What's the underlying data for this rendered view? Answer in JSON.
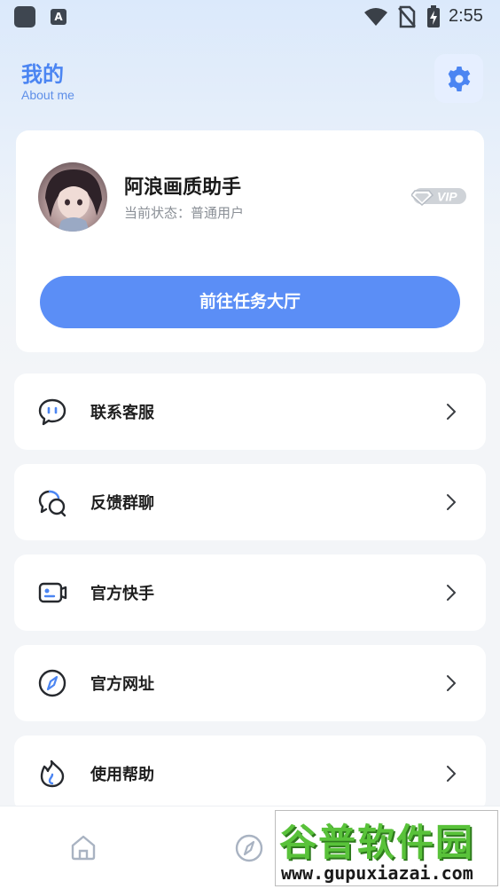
{
  "status_bar": {
    "time": "2:55",
    "app_icon_letter": "A"
  },
  "header": {
    "title": "我的",
    "subtitle": "About me",
    "settings_icon": "gear-icon",
    "accent_color": "#4b85f2"
  },
  "profile": {
    "name": "阿浪画质助手",
    "status": "当前状态：普通用户",
    "vip_label": "VIP",
    "task_button_label": "前往任务大厅",
    "button_color": "#5b8ef6"
  },
  "menu": [
    {
      "label": "联系客服",
      "icon": "chat-bubble-icon"
    },
    {
      "label": "反馈群聊",
      "icon": "group-chat-icon"
    },
    {
      "label": "官方快手",
      "icon": "video-camera-icon"
    },
    {
      "label": "官方网址",
      "icon": "compass-icon"
    },
    {
      "label": "使用帮助",
      "icon": "flame-icon"
    }
  ],
  "bottom_nav": [
    {
      "icon": "home-icon"
    },
    {
      "icon": "compass-icon"
    },
    {
      "icon": "user-icon"
    }
  ],
  "watermark": {
    "title": "谷普软件园",
    "url": "www.gupuxiazai.com"
  }
}
